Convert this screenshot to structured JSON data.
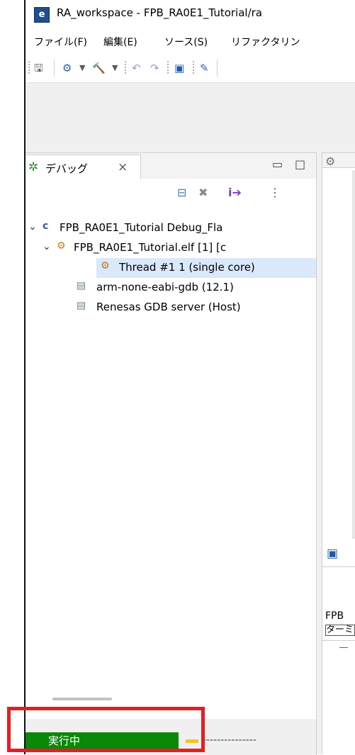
{
  "window": {
    "title": "RA_workspace - FPB_RA0E1_Tutorial/ra",
    "app_icon": "e"
  },
  "menubar": {
    "items": [
      "ファイル(F)",
      "編集(E)",
      "ソース(S)",
      "リファクタリン"
    ]
  },
  "toolbar": {
    "icons": [
      "save-icon",
      "debug-icon",
      "dropdown-arrow",
      "build-hammer-icon",
      "dropdown-arrow",
      "back-icon",
      "forward-icon",
      "console-icon",
      "pin-icon"
    ]
  },
  "debug_view": {
    "tab_label": "デバッグ",
    "close_glyph": "×",
    "tree": [
      {
        "label": "FPB_RA0E1_Tutorial Debug_Fla",
        "expanded": true,
        "level": 0
      },
      {
        "label": "FPB_RA0E1_Tutorial.elf [1] [c",
        "expanded": true,
        "level": 1
      },
      {
        "label": "Thread #1 1 (single core)",
        "selected": true,
        "level": 2
      },
      {
        "label": "arm-none-eabi-gdb (12.1)",
        "level": 2
      },
      {
        "label": "Renesas GDB server (Host)",
        "level": 2
      }
    ]
  },
  "status": {
    "progress_label": "実行中",
    "progress_color": "#0a880a",
    "dashes": "---------------"
  },
  "console": {
    "line1": "FPB",
    "line2": "ターミ"
  },
  "colors": {
    "highlight": "#e31e24",
    "selection": "#d9e8fb"
  }
}
